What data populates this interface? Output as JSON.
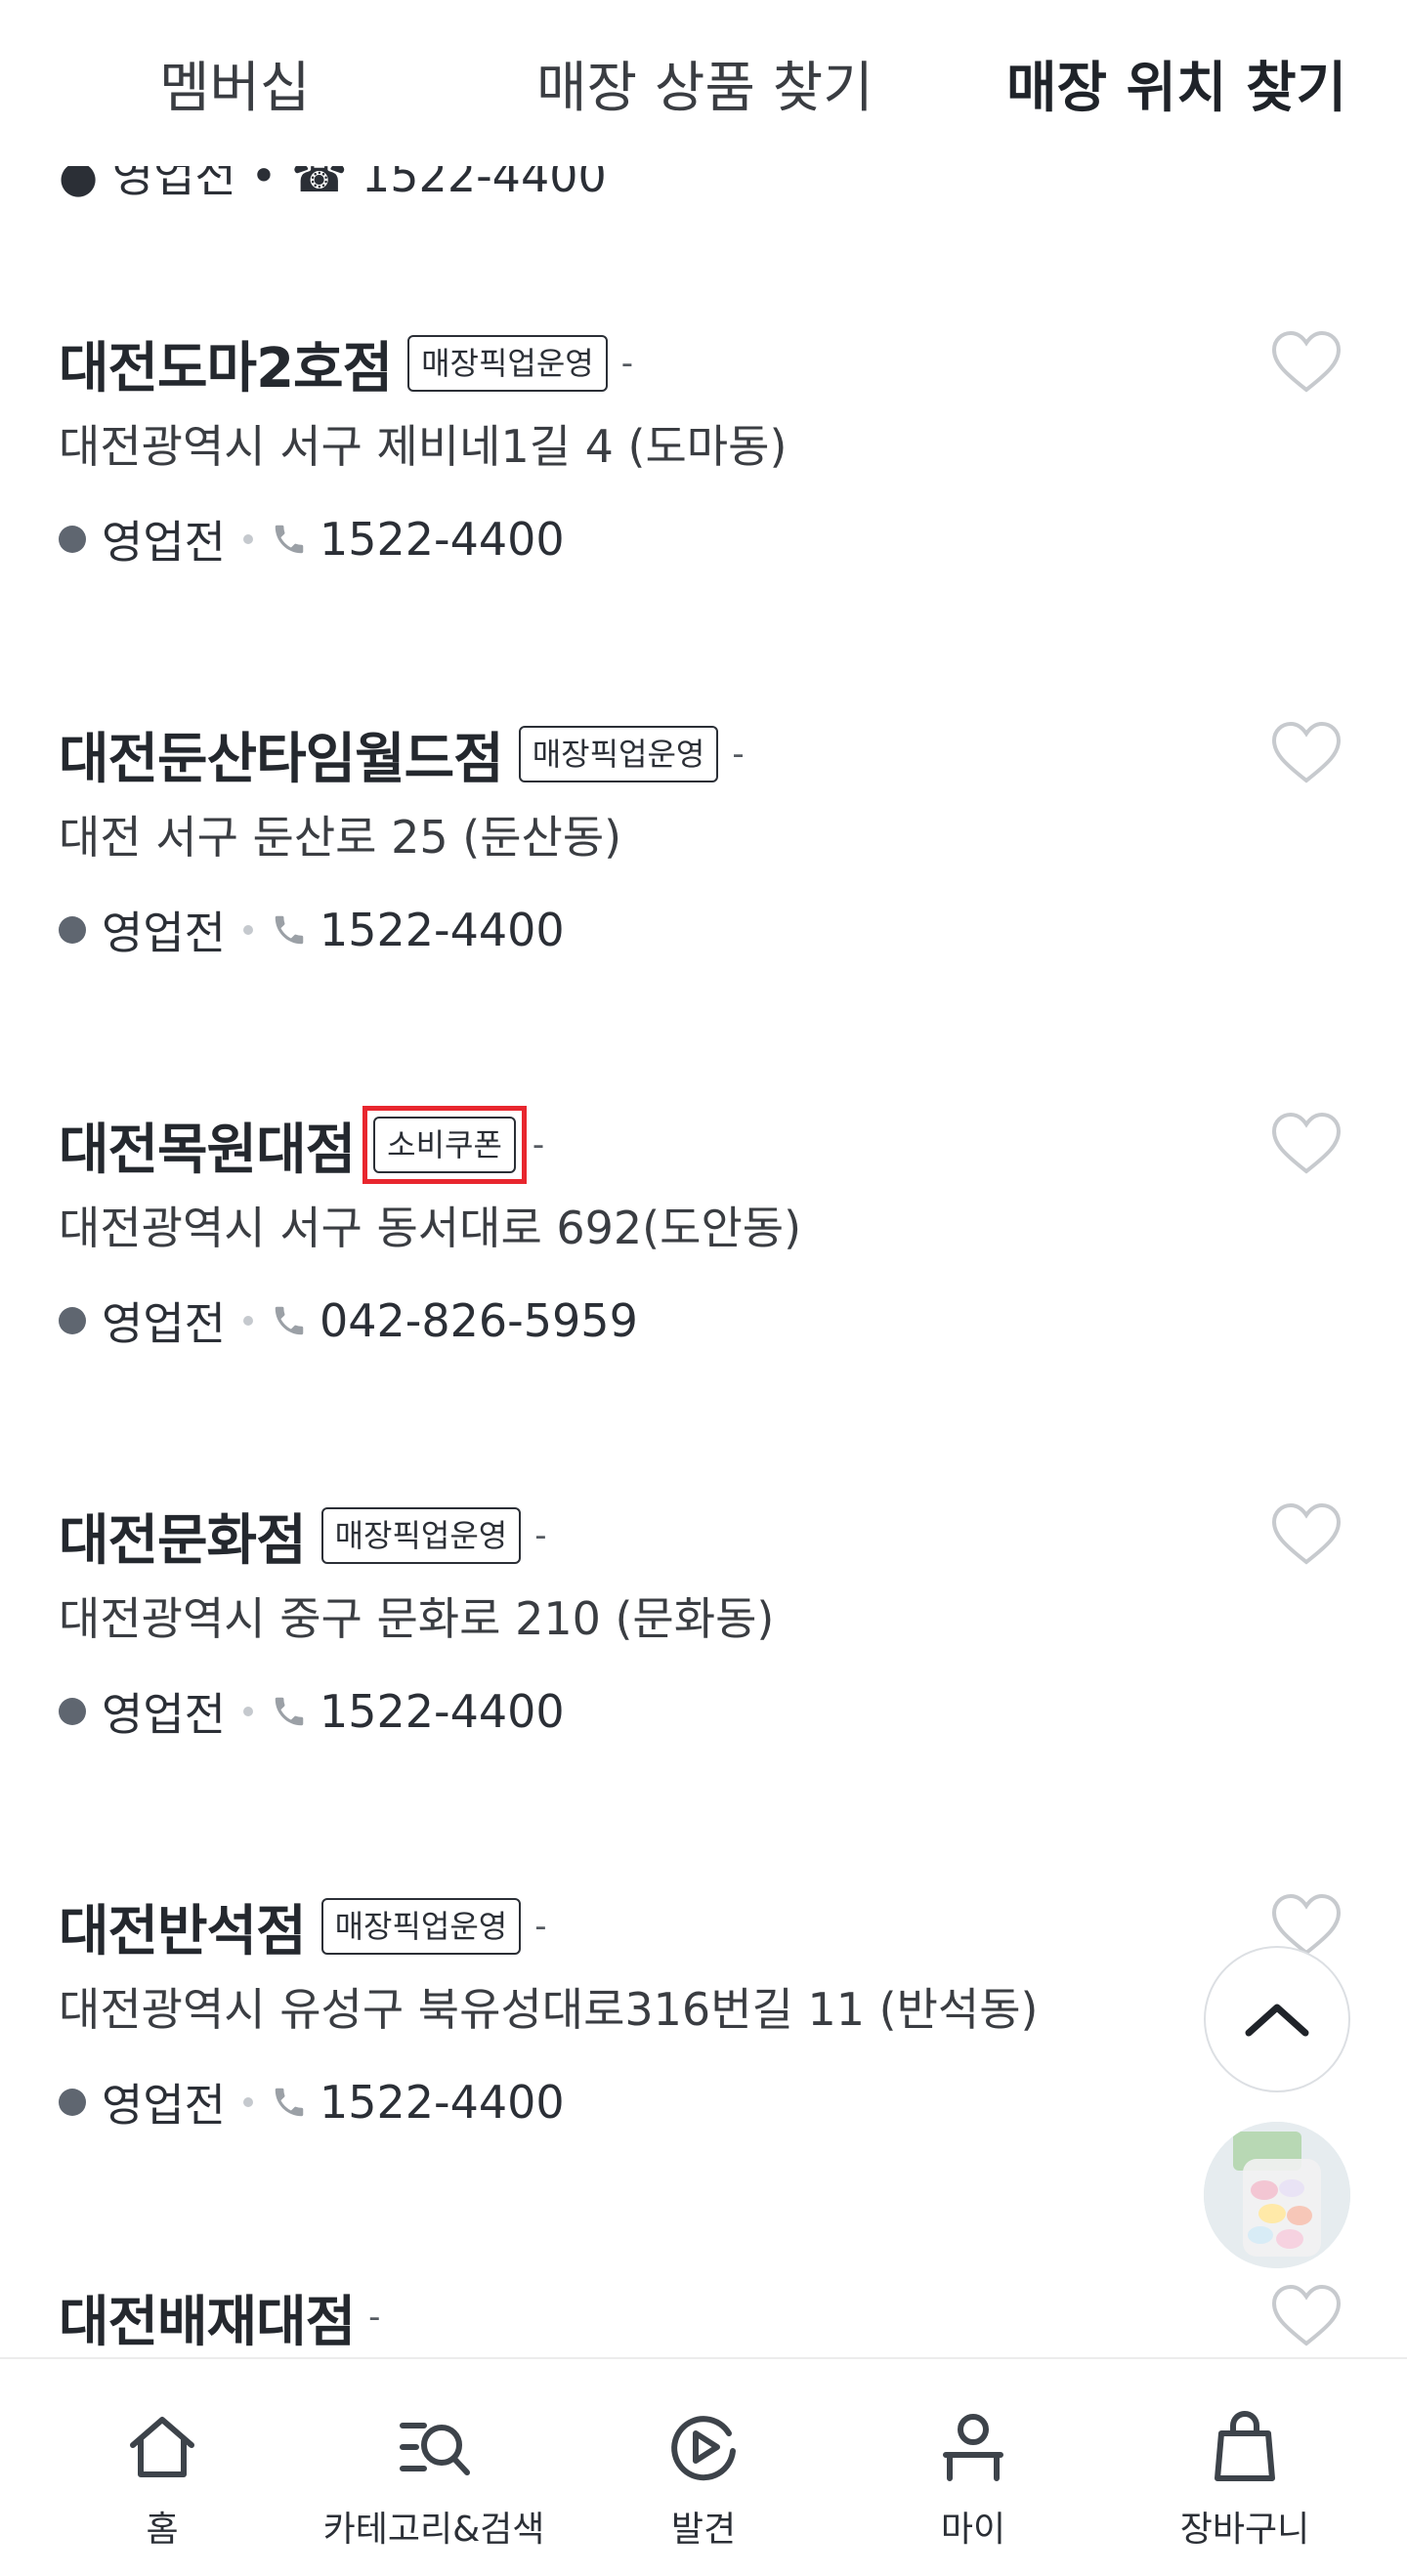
{
  "tabs": [
    {
      "label": "멤버십"
    },
    {
      "label": "매장 상품 찾기"
    },
    {
      "label": "매장 위치 찾기",
      "active": true
    }
  ],
  "partial_row": {
    "text": "● 영업전 • ☎ 1522-4400"
  },
  "stores": [
    {
      "name": "대전도마2호점",
      "tag": "매장픽업운영",
      "dash": "-",
      "address": "대전광역시 서구 제비네1길 4 (도마동)",
      "status": "영업전",
      "phone": "1522-4400"
    },
    {
      "name": "대전둔산타임월드점",
      "tag": "매장픽업운영",
      "dash": "-",
      "address": "대전 서구 둔산로 25 (둔산동)",
      "status": "영업전",
      "phone": "1522-4400"
    },
    {
      "name": "대전목원대점",
      "tag": "소비쿠폰",
      "dash": "-",
      "address": "대전광역시 서구 동서대로 692(도안동)",
      "status": "영업전",
      "phone": "042-826-5959",
      "highlighted": true
    },
    {
      "name": "대전문화점",
      "tag": "매장픽업운영",
      "dash": "-",
      "address": "대전광역시 중구 문화로 210 (문화동)",
      "status": "영업전",
      "phone": "1522-4400"
    },
    {
      "name": "대전반석점",
      "tag": "매장픽업운영",
      "dash": "-",
      "address": "대전광역시 유성구 북유성대로316번길 11 (반석동)",
      "status": "영업전",
      "phone": "1522-4400"
    },
    {
      "name": "대전배재대점",
      "tag": "",
      "dash": "-",
      "address": "",
      "status": "",
      "phone": ""
    }
  ],
  "bottom_nav": [
    {
      "label": "홈",
      "icon": "home-icon"
    },
    {
      "label": "카테고리&검색",
      "icon": "category-search-icon"
    },
    {
      "label": "발견",
      "icon": "discover-play-icon"
    },
    {
      "label": "마이",
      "icon": "person-icon"
    },
    {
      "label": "장바구니",
      "icon": "shopping-bag-icon"
    }
  ],
  "colors": {
    "highlight": "#e8262e",
    "text": "#2b2f36",
    "status_dot": "#5f6670"
  }
}
